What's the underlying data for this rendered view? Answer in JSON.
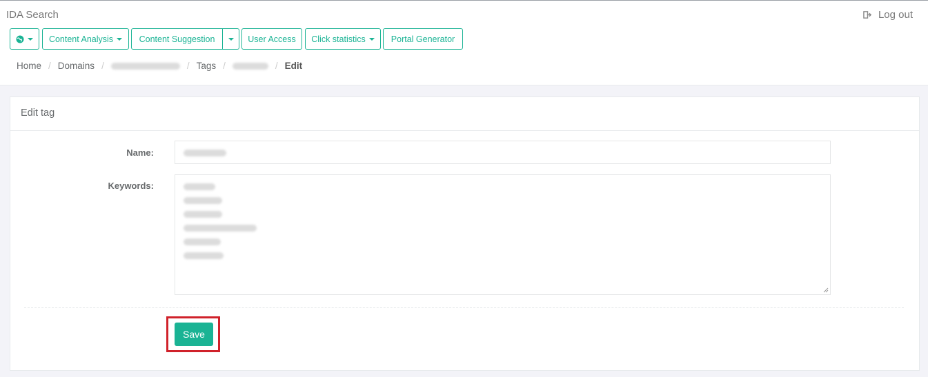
{
  "app": {
    "title": "IDA Search",
    "logout_label": "Log out"
  },
  "nav": {
    "buttons": [
      {
        "label": "",
        "icon": "globe-icon",
        "dropdown": true
      },
      {
        "label": "Content Analysis",
        "dropdown": true
      },
      {
        "label": "Content Suggestion",
        "split_dropdown": true
      },
      {
        "label": "User Access",
        "dropdown": false
      },
      {
        "label": "Click statistics",
        "dropdown": true
      },
      {
        "label": "Portal Generator",
        "dropdown": false
      }
    ]
  },
  "breadcrumb": {
    "items": [
      "Home",
      "Domains",
      "",
      "Tags",
      "",
      "Edit"
    ],
    "separator": "/"
  },
  "panel": {
    "title": "Edit tag",
    "name_label": "Name:",
    "keywords_label": "Keywords:",
    "save_label": "Save"
  },
  "colors": {
    "accent": "#1ab394",
    "highlight": "#d0212a",
    "background": "#f3f3f8"
  }
}
